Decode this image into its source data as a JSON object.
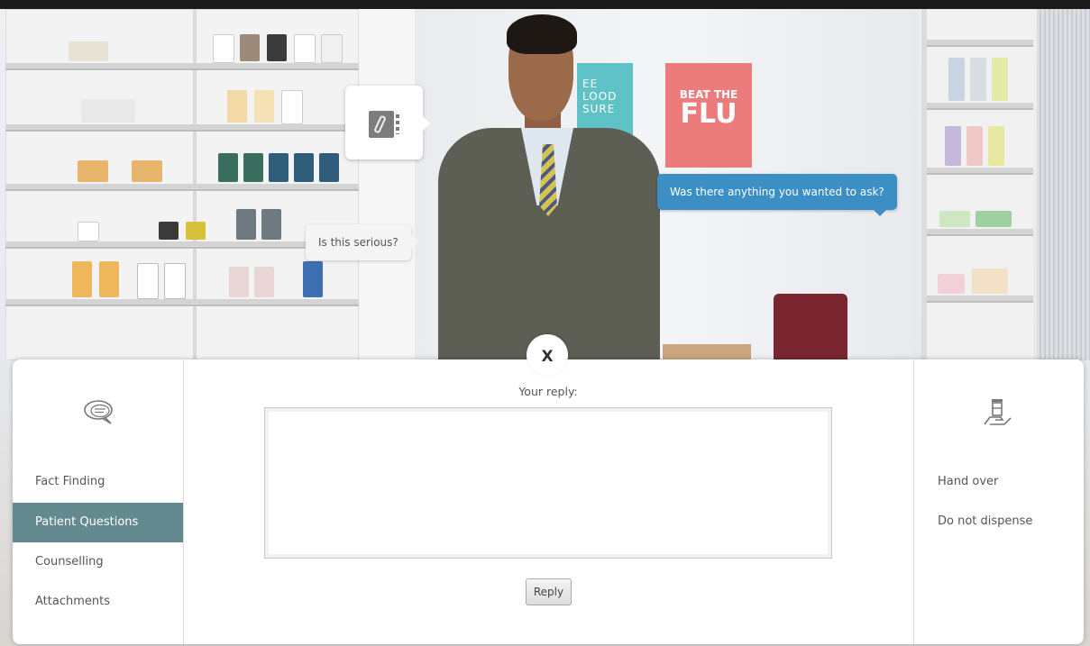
{
  "scene": {
    "bubble_patient_question": "Is this serious?",
    "bubble_pharmacist_prompt": "Was there anything you wanted to ask?",
    "poster_teal_text": "EE\nLOOD\nSURE",
    "poster_red_line1": "BEAT THE",
    "poster_red_line2": "FLU"
  },
  "panel": {
    "close_label": "X",
    "reply_label": "Your reply:",
    "reply_value": "",
    "reply_button": "Reply",
    "left_nav": {
      "icon": "chat-bubbles-icon",
      "items": [
        {
          "label": "Fact Finding",
          "active": false
        },
        {
          "label": "Patient Questions",
          "active": true
        },
        {
          "label": "Counselling",
          "active": false
        },
        {
          "label": "Attachments",
          "active": false
        }
      ]
    },
    "right_actions": {
      "icon": "hand-over-medicine-icon",
      "items": [
        {
          "label": "Hand over"
        },
        {
          "label": "Do not dispense"
        }
      ]
    }
  },
  "colors": {
    "active_nav": "#628a8f",
    "blue_bubble": "#3b8fc4",
    "panel_bg": "#ffffff"
  }
}
